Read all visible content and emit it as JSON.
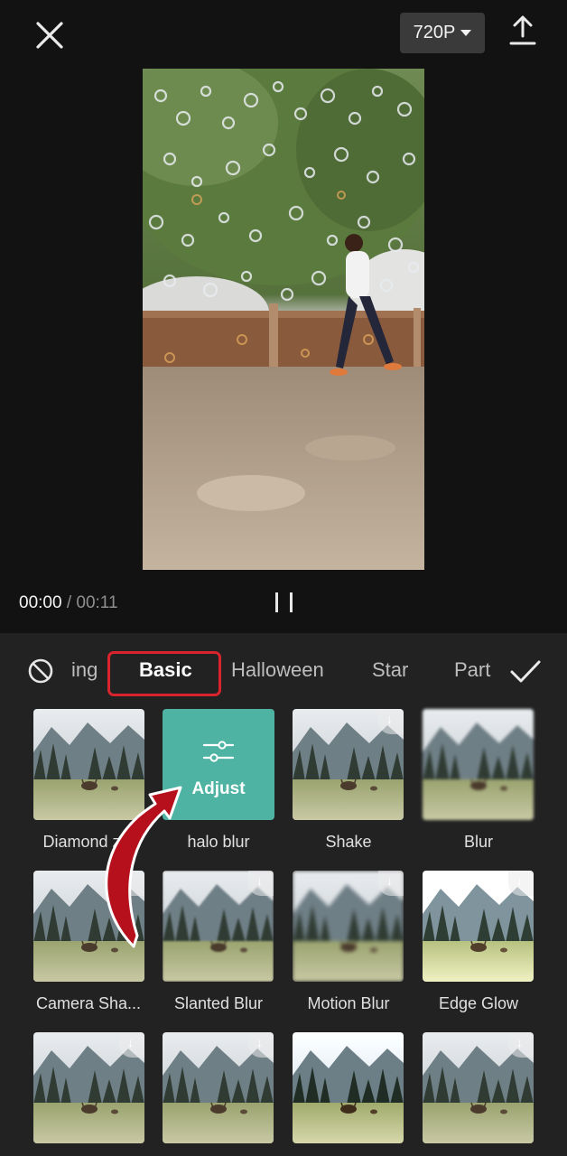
{
  "topbar": {
    "resolution": "720P"
  },
  "player": {
    "current_time": "00:00",
    "separator": "/",
    "total_time": "00:11"
  },
  "tabs": [
    "ing",
    "Basic",
    "Halloween",
    "Star",
    "Part"
  ],
  "active_tab": "Basic",
  "adjust_label": "Adjust",
  "effects": [
    {
      "label": "Diamond z..."
    },
    {
      "label": "halo blur"
    },
    {
      "label": "Shake"
    },
    {
      "label": "Blur"
    },
    {
      "label": "Camera Sha..."
    },
    {
      "label": "Slanted Blur"
    },
    {
      "label": "Motion Blur"
    },
    {
      "label": "Edge Glow"
    }
  ],
  "colors": {
    "accent_highlight": "#d9232d",
    "adjust_card": "#4fb3a3",
    "arrow": "#b5101c"
  }
}
